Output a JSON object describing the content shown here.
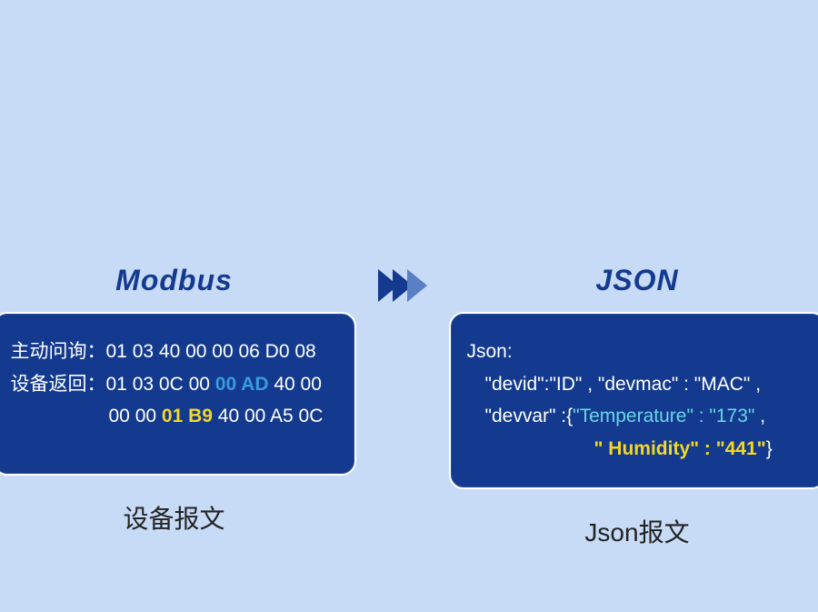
{
  "left": {
    "heading": "Modbus",
    "queryLabel": "主动问询：",
    "queryBytes": "01 03 40 00 00 06 D0 08",
    "respLabel": "设备返回：",
    "respPart1": "01 03 0C 00 ",
    "respHighlight1": "00 AD",
    "respPart2": " 40 00",
    "respLine2a": "00 00 ",
    "respHighlight2": "01 B9",
    "respLine2b": " 40 00 A5 0C",
    "caption": "设备报文"
  },
  "right": {
    "heading": "JSON",
    "jsonHeader": "Json:",
    "line1a": "\"devid\":\"ID\" , \"devmac\" : \"MAC\" ,",
    "line2a": "\"devvar\" :{",
    "line2b": "\"Temperature\" : \"173\"",
    "line2c": " ,",
    "line3a": "\" Humidity\" : \"441\"",
    "line3b": "}",
    "caption": "Json报文"
  }
}
